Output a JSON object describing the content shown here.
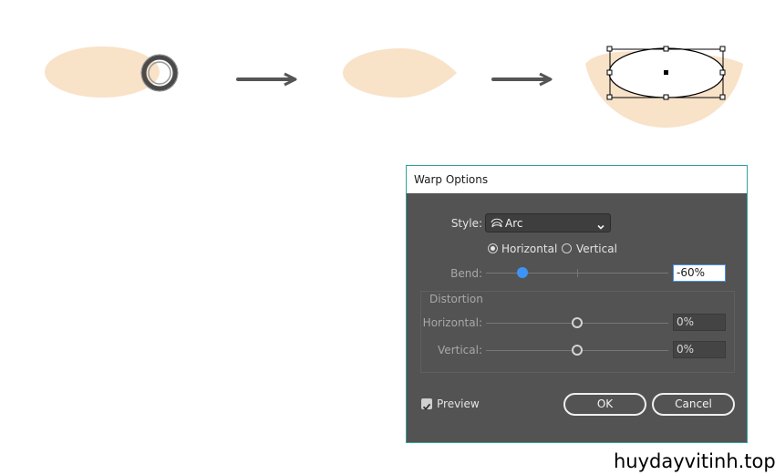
{
  "illustration": {
    "fill_color": "#f8e2c8",
    "arrow_color": "#555555",
    "step1": "ellipse-with-ring",
    "step2": "leaf-shape",
    "step3": "arc-warped-shape-selected"
  },
  "dialog": {
    "title": "Warp Options",
    "style_label": "Style:",
    "style_value": "Arc",
    "style_icon": "arc-warp-icon",
    "orientation": {
      "horizontal_label": "Horizontal",
      "vertical_label": "Vertical",
      "selected": "Horizontal"
    },
    "bend": {
      "label": "Bend:",
      "value": "-60%",
      "percent": -60
    },
    "distortion": {
      "legend": "Distortion",
      "horizontal": {
        "label": "Horizontal:",
        "value": "0%",
        "percent": 0
      },
      "vertical": {
        "label": "Vertical:",
        "value": "0%",
        "percent": 0
      }
    },
    "preview": {
      "label": "Preview",
      "checked": true
    },
    "ok_label": "OK",
    "cancel_label": "Cancel",
    "colors": {
      "border": "#2fa39a",
      "body": "#535353",
      "accent": "#3d94f6"
    }
  },
  "watermark": "huydayvitinh.top"
}
